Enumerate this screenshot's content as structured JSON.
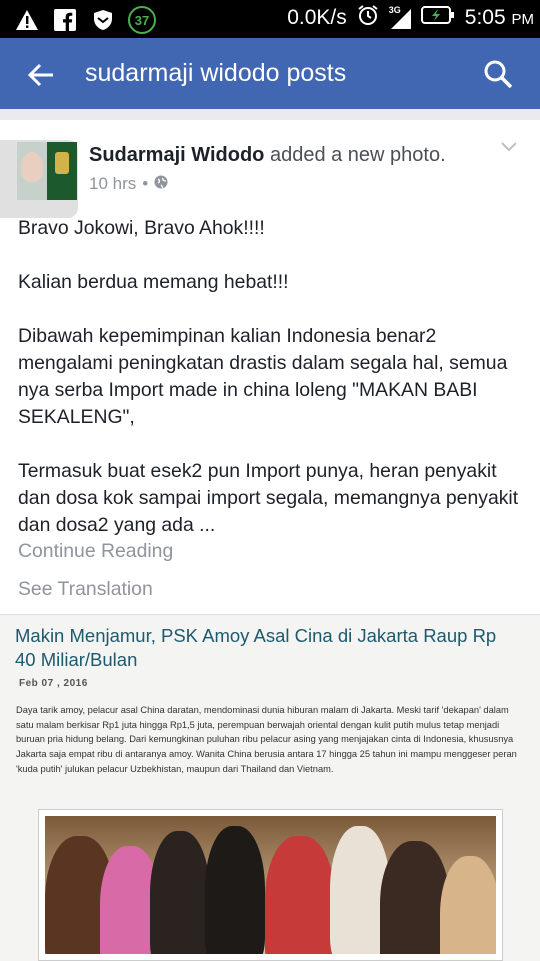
{
  "status_bar": {
    "icons": [
      "warning-icon",
      "facebook-icon",
      "shield-icon"
    ],
    "badge": "37",
    "net_speed": "0.0K/s",
    "time": "5:05",
    "ampm": "PM",
    "signal_label": "3G"
  },
  "app_bar": {
    "title": "sudarmaji widodo posts"
  },
  "post": {
    "author": "Sudarmaji Widodo",
    "action": "added a new photo.",
    "time": "10 hrs",
    "separator": "•",
    "paragraphs": [
      "Bravo Jokowi, Bravo Ahok!!!!",
      "Kalian berdua memang hebat!!!",
      "Dibawah kepemimpinan kalian Indonesia benar2 mengalami peningkatan drastis dalam segala hal, semua nya serba Import made in china loleng \"MAKAN BABI SEKALENG\",",
      "Termasuk buat esek2 pun Import punya, heran penyakit dan dosa kok sampai import segala, memangnya penyakit dan dosa2 yang ada ..."
    ],
    "continue_label": "Continue Reading",
    "translate_label": "See Translation"
  },
  "article": {
    "title": "Makin Menjamur, PSK Amoy Asal Cina di Jakarta Raup Rp 40 Miliar/Bulan",
    "date": "Feb 07 , 2016",
    "text": "Daya tarik amoy, pelacur asal China daratan, mendominasi dunia hiburan malam di Jakarta. Meski tarif 'dekapan' dalam satu malam berkisar Rp1 juta hingga Rp1,5 juta, perempuan berwajah oriental dengan kulit putih mulus tetap menjadi buruan pria hidung belang. Dari kemungkinan puluhan ribu pelacur asing yang menjajakan cinta di Indonesia, khususnya Jakarta saja empat ribu di antaranya amoy. Wanita China berusia antara 17 hingga 25 tahun ini mampu menggeser peran 'kuda putih' julukan pelacur Uzbekhistan, maupun dari Thailand dan Vietnam."
  },
  "colors": {
    "fb_blue": "#4267b2",
    "text_primary": "#1d2129",
    "text_secondary": "#90949c",
    "article_title": "#1e5a6d"
  }
}
